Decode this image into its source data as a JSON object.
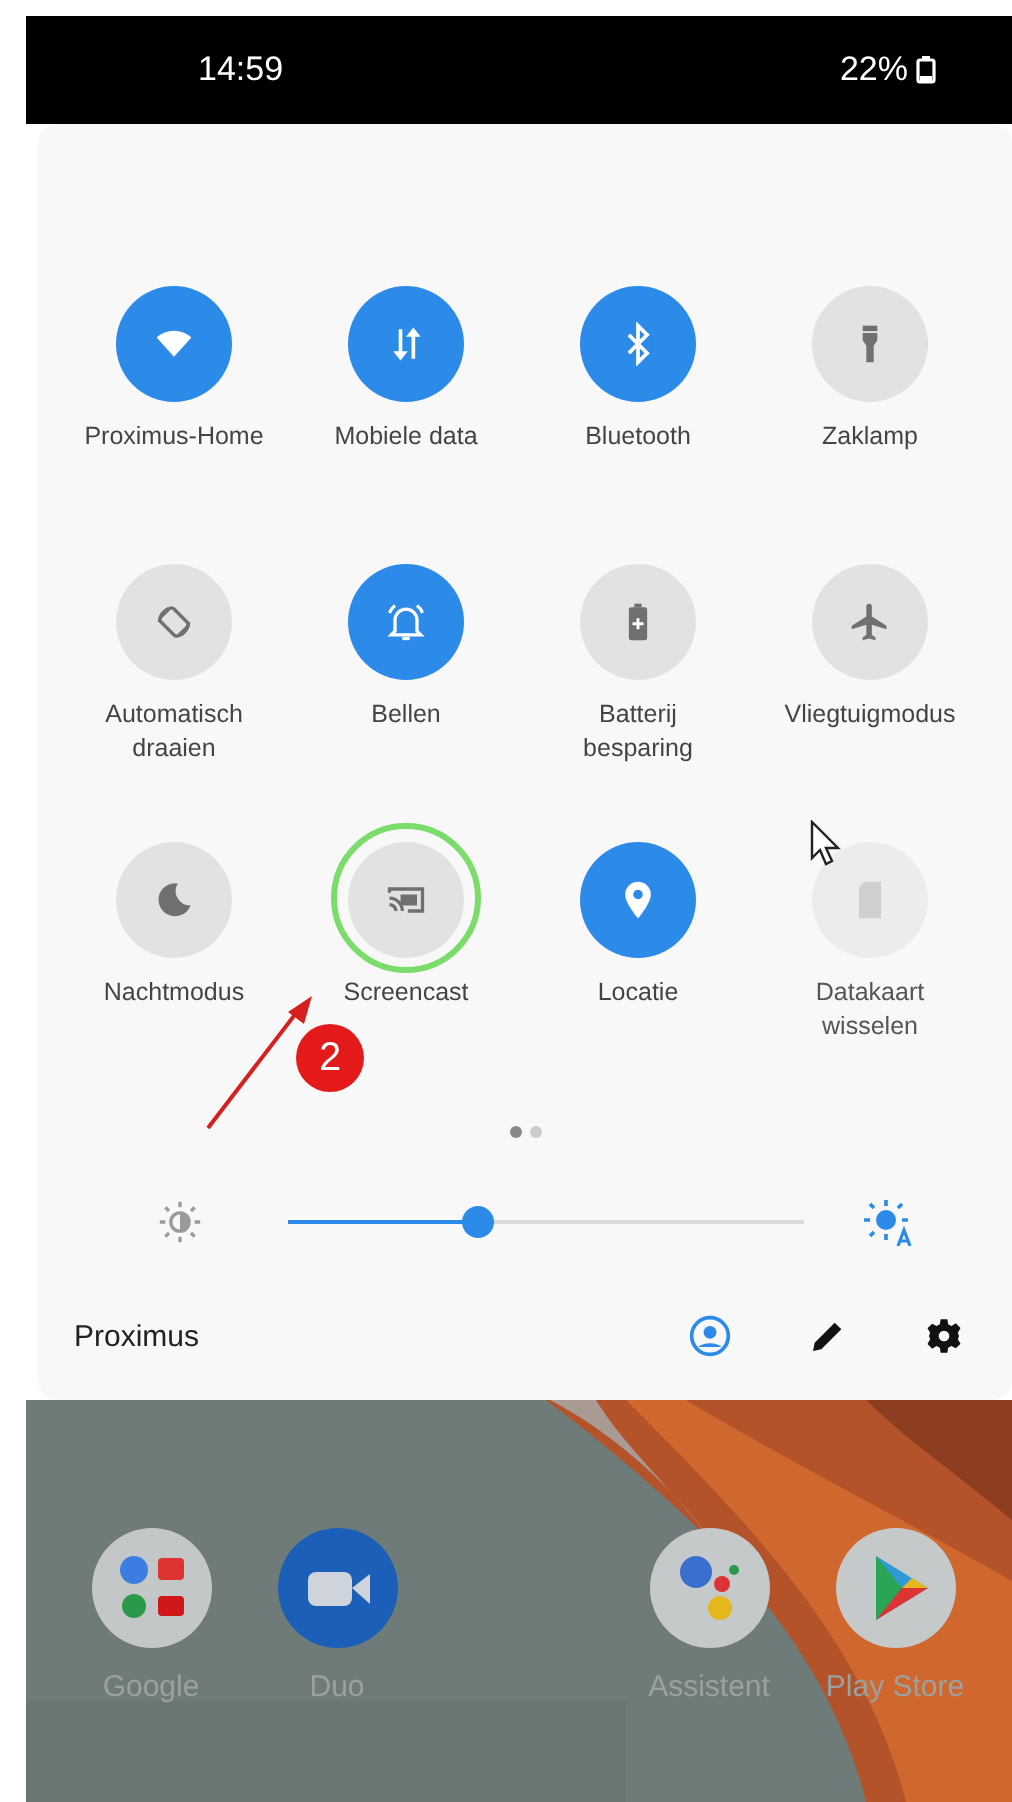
{
  "status_bar": {
    "time": "14:59",
    "battery": "22%"
  },
  "quick_settings": {
    "tiles": [
      {
        "label": "Proximus-Home",
        "on": true,
        "disabled": false
      },
      {
        "label": "Mobiele data",
        "on": true,
        "disabled": false
      },
      {
        "label": "Bluetooth",
        "on": true,
        "disabled": false
      },
      {
        "label": "Zaklamp",
        "on": false,
        "disabled": false
      },
      {
        "label": "Automatisch draaien",
        "on": false,
        "disabled": false
      },
      {
        "label": "Bellen",
        "on": true,
        "disabled": false
      },
      {
        "label": "Batterij besparing",
        "on": false,
        "disabled": false
      },
      {
        "label": "Vliegtuigmodus",
        "on": false,
        "disabled": false
      },
      {
        "label": "Nachtmodus",
        "on": false,
        "disabled": false
      },
      {
        "label": "Screencast",
        "on": false,
        "disabled": false
      },
      {
        "label": "Locatie",
        "on": true,
        "disabled": false
      },
      {
        "label": "Datakaart wisselen",
        "on": false,
        "disabled": true
      }
    ],
    "pages": [
      {
        "selected": true
      },
      {
        "selected": false
      }
    ],
    "brightness": {
      "level": 0.37
    },
    "carrier": "Proximus"
  },
  "home_apps": [
    {
      "label": "Google"
    },
    {
      "label": "Duo"
    },
    {
      "label": "Assistent"
    },
    {
      "label": "Play Store"
    }
  ],
  "annotation": {
    "badge": "2"
  }
}
